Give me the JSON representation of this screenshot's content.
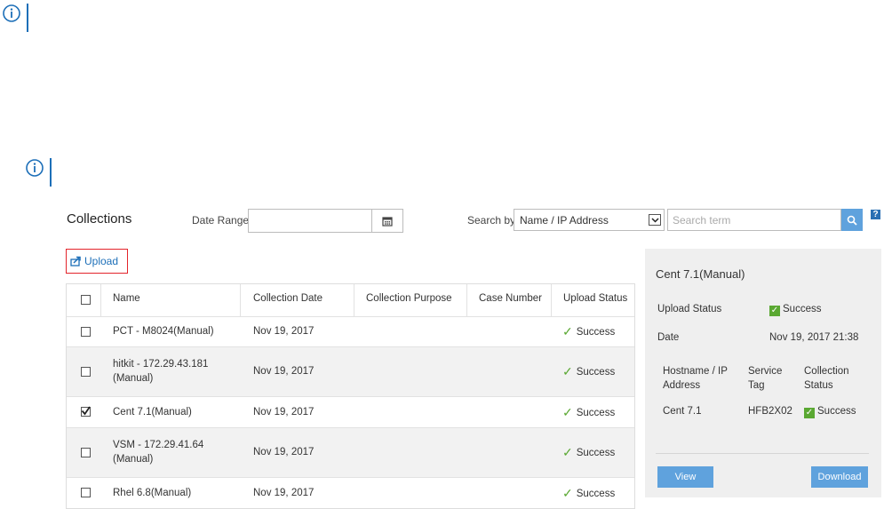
{
  "toolbar": {
    "title": "Collections",
    "date_range_label": "Date Range:",
    "date_range_value": "",
    "search_by_label": "Search by",
    "search_by_selected": "Name / IP Address",
    "search_placeholder": "Search term",
    "help_label": "?"
  },
  "upload": {
    "label": "Upload"
  },
  "table": {
    "headers": [
      "Name",
      "Collection Date",
      "Collection Purpose",
      "Case Number",
      "Upload Status"
    ],
    "rows": [
      {
        "name1": "PCT - M8024(Manual)",
        "name2": "",
        "date": "Nov 19, 2017",
        "purpose": "",
        "case": "",
        "status": "Success",
        "checked": false
      },
      {
        "name1": "hitkit - 172.29.43.181",
        "name2": "(Manual)",
        "date": "Nov 19, 2017",
        "purpose": "",
        "case": "",
        "status": "Success",
        "checked": false
      },
      {
        "name1": "Cent 7.1(Manual)",
        "name2": "",
        "date": "Nov 19, 2017",
        "purpose": "",
        "case": "",
        "status": "Success",
        "checked": true
      },
      {
        "name1": "VSM - 172.29.41.64",
        "name2": "(Manual)",
        "date": "Nov 19, 2017",
        "purpose": "",
        "case": "",
        "status": "Success",
        "checked": false
      },
      {
        "name1": "Rhel 6.8(Manual)",
        "name2": "",
        "date": "Nov 19, 2017",
        "purpose": "",
        "case": "",
        "status": "Success",
        "checked": false
      }
    ]
  },
  "details": {
    "title": "Cent 7.1(Manual)",
    "upload_status_label": "Upload Status",
    "upload_status_value": "Success",
    "date_label": "Date",
    "date_value": "Nov 19, 2017 21:38",
    "col_host_1": "Hostname / IP",
    "col_host_2": "Address",
    "col_tag_1": "Service",
    "col_tag_2": "Tag",
    "col_status_1": "Collection",
    "col_status_2": "Status",
    "host": "Cent 7.1",
    "service_tag": "HFB2X02",
    "collection_status": "Success",
    "view_label": "View",
    "download_label": "Download"
  },
  "colors": {
    "accent": "#5fa2dd",
    "success": "#5aa832",
    "highlight": "#e3242b",
    "note": "#1d6fb8"
  },
  "icons": [
    "info-icon",
    "calendar-icon",
    "chevron-down-icon",
    "search-icon",
    "help-icon",
    "upload-icon",
    "checkmark-icon"
  ]
}
